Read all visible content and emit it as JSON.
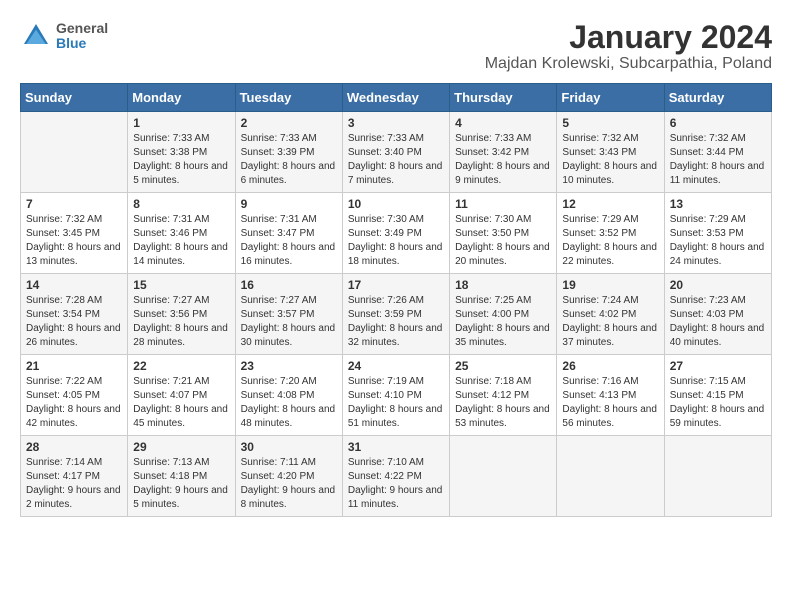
{
  "header": {
    "logo_line1": "General",
    "logo_line2": "Blue",
    "title": "January 2024",
    "subtitle": "Majdan Krolewski, Subcarpathia, Poland"
  },
  "calendar": {
    "days_of_week": [
      "Sunday",
      "Monday",
      "Tuesday",
      "Wednesday",
      "Thursday",
      "Friday",
      "Saturday"
    ],
    "weeks": [
      [
        {
          "day": "",
          "sunrise": "",
          "sunset": "",
          "daylight": ""
        },
        {
          "day": "1",
          "sunrise": "Sunrise: 7:33 AM",
          "sunset": "Sunset: 3:38 PM",
          "daylight": "Daylight: 8 hours and 5 minutes."
        },
        {
          "day": "2",
          "sunrise": "Sunrise: 7:33 AM",
          "sunset": "Sunset: 3:39 PM",
          "daylight": "Daylight: 8 hours and 6 minutes."
        },
        {
          "day": "3",
          "sunrise": "Sunrise: 7:33 AM",
          "sunset": "Sunset: 3:40 PM",
          "daylight": "Daylight: 8 hours and 7 minutes."
        },
        {
          "day": "4",
          "sunrise": "Sunrise: 7:33 AM",
          "sunset": "Sunset: 3:42 PM",
          "daylight": "Daylight: 8 hours and 9 minutes."
        },
        {
          "day": "5",
          "sunrise": "Sunrise: 7:32 AM",
          "sunset": "Sunset: 3:43 PM",
          "daylight": "Daylight: 8 hours and 10 minutes."
        },
        {
          "day": "6",
          "sunrise": "Sunrise: 7:32 AM",
          "sunset": "Sunset: 3:44 PM",
          "daylight": "Daylight: 8 hours and 11 minutes."
        }
      ],
      [
        {
          "day": "7",
          "sunrise": "Sunrise: 7:32 AM",
          "sunset": "Sunset: 3:45 PM",
          "daylight": "Daylight: 8 hours and 13 minutes."
        },
        {
          "day": "8",
          "sunrise": "Sunrise: 7:31 AM",
          "sunset": "Sunset: 3:46 PM",
          "daylight": "Daylight: 8 hours and 14 minutes."
        },
        {
          "day": "9",
          "sunrise": "Sunrise: 7:31 AM",
          "sunset": "Sunset: 3:47 PM",
          "daylight": "Daylight: 8 hours and 16 minutes."
        },
        {
          "day": "10",
          "sunrise": "Sunrise: 7:30 AM",
          "sunset": "Sunset: 3:49 PM",
          "daylight": "Daylight: 8 hours and 18 minutes."
        },
        {
          "day": "11",
          "sunrise": "Sunrise: 7:30 AM",
          "sunset": "Sunset: 3:50 PM",
          "daylight": "Daylight: 8 hours and 20 minutes."
        },
        {
          "day": "12",
          "sunrise": "Sunrise: 7:29 AM",
          "sunset": "Sunset: 3:52 PM",
          "daylight": "Daylight: 8 hours and 22 minutes."
        },
        {
          "day": "13",
          "sunrise": "Sunrise: 7:29 AM",
          "sunset": "Sunset: 3:53 PM",
          "daylight": "Daylight: 8 hours and 24 minutes."
        }
      ],
      [
        {
          "day": "14",
          "sunrise": "Sunrise: 7:28 AM",
          "sunset": "Sunset: 3:54 PM",
          "daylight": "Daylight: 8 hours and 26 minutes."
        },
        {
          "day": "15",
          "sunrise": "Sunrise: 7:27 AM",
          "sunset": "Sunset: 3:56 PM",
          "daylight": "Daylight: 8 hours and 28 minutes."
        },
        {
          "day": "16",
          "sunrise": "Sunrise: 7:27 AM",
          "sunset": "Sunset: 3:57 PM",
          "daylight": "Daylight: 8 hours and 30 minutes."
        },
        {
          "day": "17",
          "sunrise": "Sunrise: 7:26 AM",
          "sunset": "Sunset: 3:59 PM",
          "daylight": "Daylight: 8 hours and 32 minutes."
        },
        {
          "day": "18",
          "sunrise": "Sunrise: 7:25 AM",
          "sunset": "Sunset: 4:00 PM",
          "daylight": "Daylight: 8 hours and 35 minutes."
        },
        {
          "day": "19",
          "sunrise": "Sunrise: 7:24 AM",
          "sunset": "Sunset: 4:02 PM",
          "daylight": "Daylight: 8 hours and 37 minutes."
        },
        {
          "day": "20",
          "sunrise": "Sunrise: 7:23 AM",
          "sunset": "Sunset: 4:03 PM",
          "daylight": "Daylight: 8 hours and 40 minutes."
        }
      ],
      [
        {
          "day": "21",
          "sunrise": "Sunrise: 7:22 AM",
          "sunset": "Sunset: 4:05 PM",
          "daylight": "Daylight: 8 hours and 42 minutes."
        },
        {
          "day": "22",
          "sunrise": "Sunrise: 7:21 AM",
          "sunset": "Sunset: 4:07 PM",
          "daylight": "Daylight: 8 hours and 45 minutes."
        },
        {
          "day": "23",
          "sunrise": "Sunrise: 7:20 AM",
          "sunset": "Sunset: 4:08 PM",
          "daylight": "Daylight: 8 hours and 48 minutes."
        },
        {
          "day": "24",
          "sunrise": "Sunrise: 7:19 AM",
          "sunset": "Sunset: 4:10 PM",
          "daylight": "Daylight: 8 hours and 51 minutes."
        },
        {
          "day": "25",
          "sunrise": "Sunrise: 7:18 AM",
          "sunset": "Sunset: 4:12 PM",
          "daylight": "Daylight: 8 hours and 53 minutes."
        },
        {
          "day": "26",
          "sunrise": "Sunrise: 7:16 AM",
          "sunset": "Sunset: 4:13 PM",
          "daylight": "Daylight: 8 hours and 56 minutes."
        },
        {
          "day": "27",
          "sunrise": "Sunrise: 7:15 AM",
          "sunset": "Sunset: 4:15 PM",
          "daylight": "Daylight: 8 hours and 59 minutes."
        }
      ],
      [
        {
          "day": "28",
          "sunrise": "Sunrise: 7:14 AM",
          "sunset": "Sunset: 4:17 PM",
          "daylight": "Daylight: 9 hours and 2 minutes."
        },
        {
          "day": "29",
          "sunrise": "Sunrise: 7:13 AM",
          "sunset": "Sunset: 4:18 PM",
          "daylight": "Daylight: 9 hours and 5 minutes."
        },
        {
          "day": "30",
          "sunrise": "Sunrise: 7:11 AM",
          "sunset": "Sunset: 4:20 PM",
          "daylight": "Daylight: 9 hours and 8 minutes."
        },
        {
          "day": "31",
          "sunrise": "Sunrise: 7:10 AM",
          "sunset": "Sunset: 4:22 PM",
          "daylight": "Daylight: 9 hours and 11 minutes."
        },
        {
          "day": "",
          "sunrise": "",
          "sunset": "",
          "daylight": ""
        },
        {
          "day": "",
          "sunrise": "",
          "sunset": "",
          "daylight": ""
        },
        {
          "day": "",
          "sunrise": "",
          "sunset": "",
          "daylight": ""
        }
      ]
    ]
  }
}
